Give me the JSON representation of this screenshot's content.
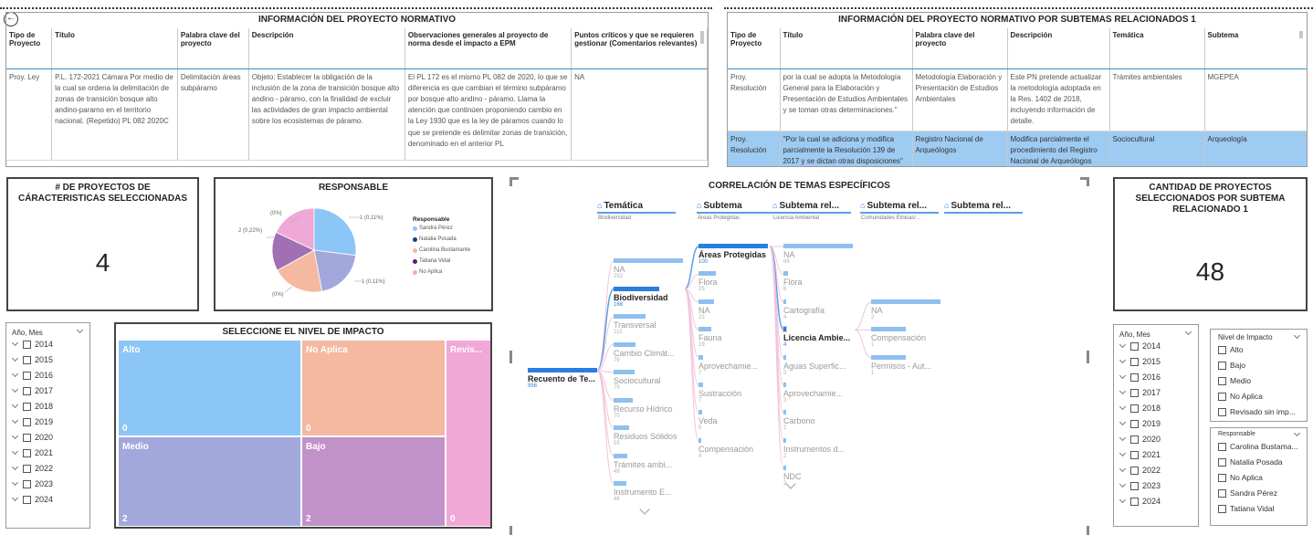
{
  "back_icon": "back-arrow-icon",
  "table1": {
    "title": "INFORMACIÓN DEL PROYECTO NORMATIVO",
    "columns": [
      "Tipo de Proyecto",
      "Título",
      "Palabra clave del proyecto",
      "Descripción",
      "Observaciones generales al proyecto de norma desde el impacto a EPM",
      "Puntos críticos y que se requieren gestionar (Comentarios relevantes)"
    ],
    "rows": [
      [
        "Proy. Ley",
        "P.L. 172-2021 Cámara Por medio de la cual se ordena la delimitación de zonas de transición bosque alto andino-paramo en el territorio nacional. (Repetido) PL 082 2020C",
        "Delimitación áreas subpáramo",
        "Objeto: Establecer la obligación de la inclusión de la zona de transición bosque alto andino - páramo, con la finalidad de excluir las actividades de gran impacto ambiental sobre los ecosistemas de páramo.",
        "El PL 172 es el mismo PL 082 de 2020, lo que se diferencia es que cambian el término subpáramo por bosque alto andino - páramo. Llama la atención que continúen proponiendo cambio en la Ley 1930 que es la ley de páramos cuando lo que se pretende es delimitar zonas de transición, denominado en el anterior PL",
        "NA"
      ]
    ]
  },
  "table2": {
    "title": "INFORMACIÓN DEL PROYECTO NORMATIVO POR SUBTEMAS RELACIONADOS 1",
    "columns": [
      "Tipo de Proyecto",
      "Título",
      "Palabra clave del proyecto",
      "Descripción",
      "Temática",
      "Subtema"
    ],
    "rows": [
      [
        "Proy. Resolución",
        "por la cual se adopta la Metodología General para la Elaboración y Presentación de Estudios Ambientales y se toman otras determinaciones.\"",
        "Metodología Elaboración y Presentación de Estudios Ambientales",
        "Este PN pretende actualizar la metodología adoptada en la Res. 1402 de 2018, incluyendo información de detalle.",
        "Trámites ambientales",
        "MGEPEA"
      ],
      [
        "Proy. Resolución",
        "\"Por la cual se adiciona y modifica parcialmente la Resolución 139 de 2017 y se dictan otras disposiciones\"",
        "Registro Nacional de Arqueólogos",
        "Modifica parcialmente el procedimiento del Registro Nacional de Arqueólogos establecido",
        "Sociocultural",
        "Arqueología"
      ]
    ]
  },
  "card1": {
    "title": "# DE PROYECTOS DE CÁRACTERISTICAS SELECCIONADAS",
    "value": "4"
  },
  "card2": {
    "title": "CANTIDAD DE PROYECTOS SELECCIONADOS POR SUBTEMA RELACIONADO 1",
    "value": "48"
  },
  "pie": {
    "title": "RESPONSABLE",
    "legend_title": "Responsable",
    "labels": {
      "top_left": "(0%)",
      "top_right": "1 (0,11%)",
      "left": "2 (0,22%)",
      "right": "1 (0,11%)",
      "bottom_left": "(0%)"
    }
  },
  "chart_data": {
    "type": "pie",
    "title": "RESPONSABLE",
    "legend_title": "Responsable",
    "series": [
      {
        "name": "Sandra Pérez",
        "value": 1,
        "color": "#8cc6f6"
      },
      {
        "name": "Natalia Posada",
        "value": 0,
        "color": "#1d3a8a"
      },
      {
        "name": "Carolina Bustamante",
        "value": 1,
        "color": "#f4b9a0"
      },
      {
        "name": "Tatiana Vidal",
        "value": 0,
        "color": "#6a0f85"
      },
      {
        "name": "No Aplica",
        "value": 1,
        "color": "#f0a8d6"
      }
    ]
  },
  "pie_slices": [
    {
      "name": "Sandra Pérez",
      "share": 0.27,
      "color": "#8cc6f6"
    },
    {
      "name": "Natalia Posada",
      "share": 0.2,
      "color": "#a3a8dc"
    },
    {
      "name": "Carolina Bustamante",
      "share": 0.2,
      "color": "#f4b9a0"
    },
    {
      "name": "Tatiana Vidal",
      "share": 0.15,
      "color": "#a16fb4"
    },
    {
      "name": "No Aplica",
      "share": 0.18,
      "color": "#f0a8d6"
    }
  ],
  "treemap": {
    "title": "SELECCIONE EL NIVEL DE IMPACTO",
    "cells": [
      {
        "label": "Alto",
        "value": "0",
        "color": "#8cc6f6"
      },
      {
        "label": "No Aplica",
        "value": "0",
        "color": "#f4b9a0"
      },
      {
        "label": "Revis...",
        "value": "0",
        "color": "#f0a8d6"
      },
      {
        "label": "Medio",
        "value": "2",
        "color": "#a3a8dc"
      },
      {
        "label": "Bajo",
        "value": "2",
        "color": "#c192c8"
      }
    ]
  },
  "slicer_left": {
    "title": "Año, Mes",
    "years": [
      "2014",
      "2015",
      "2016",
      "2017",
      "2018",
      "2019",
      "2020",
      "2021",
      "2022",
      "2023",
      "2024"
    ]
  },
  "slicer_right": {
    "title": "Año, Mes",
    "years": [
      "2014",
      "2015",
      "2016",
      "2017",
      "2018",
      "2019",
      "2020",
      "2021",
      "2022",
      "2023",
      "2024"
    ]
  },
  "impact_slicer": {
    "title": "Nivel de Impacto",
    "options": [
      "Alto",
      "Bajo",
      "Medio",
      "No Aplica",
      "Revisado sin imp..."
    ]
  },
  "resp_slicer": {
    "title": "Responsable",
    "options": [
      "Carolina Bustama...",
      "Natalia Posada",
      "No Aplica",
      "Sandra Pérez",
      "Tatiana Vidal"
    ]
  },
  "decomp": {
    "title": "CORRELACIÓN DE TEMAS ESPECÍFICOS",
    "levels": [
      {
        "label": "Temática",
        "sub": "Biodiversidad"
      },
      {
        "label": "Subtema",
        "sub": "Áreas Protegidas"
      },
      {
        "label": "Subtema rel...",
        "sub": "Licencia Ambiental"
      },
      {
        "label": "Subtema rel...",
        "sub": "Comunidades Étnicas/..."
      },
      {
        "label": "Subtema rel...",
        "sub": ""
      }
    ],
    "root": {
      "label": "Recuento de Te...",
      "value": "956"
    },
    "col1": [
      {
        "label": "NA",
        "value": "253"
      },
      {
        "label": "Biodiversidad",
        "value": "168"
      },
      {
        "label": "Transversal",
        "value": "115"
      },
      {
        "label": "Cambio Climát...",
        "value": "79"
      },
      {
        "label": "Sociocultural",
        "value": "75"
      },
      {
        "label": "Recurso Hídrico",
        "value": "70"
      },
      {
        "label": "Residuos Sólidos",
        "value": "55"
      },
      {
        "label": "Trámites ambi...",
        "value": "49"
      },
      {
        "label": "Instrumento E...",
        "value": "46"
      }
    ],
    "col2": [
      {
        "label": "Áreas Protegidas",
        "value": "100"
      },
      {
        "label": "Flora",
        "value": "25"
      },
      {
        "label": "NA",
        "value": "23"
      },
      {
        "label": "Fauna",
        "value": "19"
      },
      {
        "label": "Aprovechamie...",
        "value": "7"
      },
      {
        "label": "Sustracción",
        "value": "7"
      },
      {
        "label": "Veda",
        "value": "5"
      },
      {
        "label": "Compensación",
        "value": "4"
      }
    ],
    "col3": [
      {
        "label": "NA",
        "value": "89"
      },
      {
        "label": "Flora",
        "value": "6"
      },
      {
        "label": "Cartografía",
        "value": "4"
      },
      {
        "label": "Licencia Ambie...",
        "value": "4"
      },
      {
        "label": "Aguas Superfic...",
        "value": "3"
      },
      {
        "label": "Aprovechamie...",
        "value": "3"
      },
      {
        "label": "Carbono",
        "value": "2"
      },
      {
        "label": "Instrumentos d...",
        "value": "2"
      },
      {
        "label": "NDC",
        "value": "2"
      }
    ],
    "col4": [
      {
        "label": "NA",
        "value": "2"
      },
      {
        "label": "Compensación",
        "value": "1"
      },
      {
        "label": "Permisos - Aut...",
        "value": "1"
      }
    ]
  }
}
